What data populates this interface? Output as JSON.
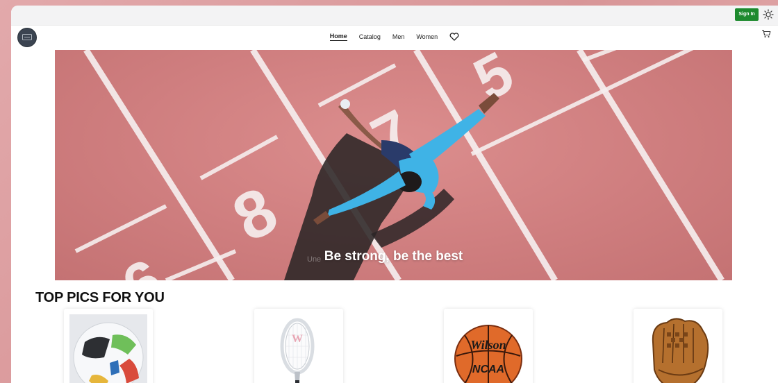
{
  "header": {
    "signin_label": "Sign In",
    "theme_icon": "sun-icon",
    "logo_icon": "brand-logo"
  },
  "nav": {
    "items": [
      {
        "label": "Home",
        "active": true
      },
      {
        "label": "Catalog",
        "active": false
      },
      {
        "label": "Men",
        "active": false
      },
      {
        "label": "Women",
        "active": false
      }
    ],
    "favorites_icon": "heart-icon",
    "cart_icon": "cart-icon"
  },
  "hero": {
    "caption": "Be strong, be the best",
    "ghost_text": "Une",
    "track_numbers": [
      "8",
      "7",
      "6",
      "5"
    ]
  },
  "section": {
    "title": "TOP PICS FOR YOU"
  },
  "products": [
    {
      "icon": "soccer-ball-image"
    },
    {
      "icon": "tennis-racket-image"
    },
    {
      "icon": "basketball-image",
      "brand": "Wilson",
      "league": "NCAA"
    },
    {
      "icon": "baseball-glove-image"
    }
  ],
  "colors": {
    "signin_bg": "#1d8a2e",
    "hero_track": "#cf7e7f",
    "athlete_top": "#3fb3e6"
  }
}
